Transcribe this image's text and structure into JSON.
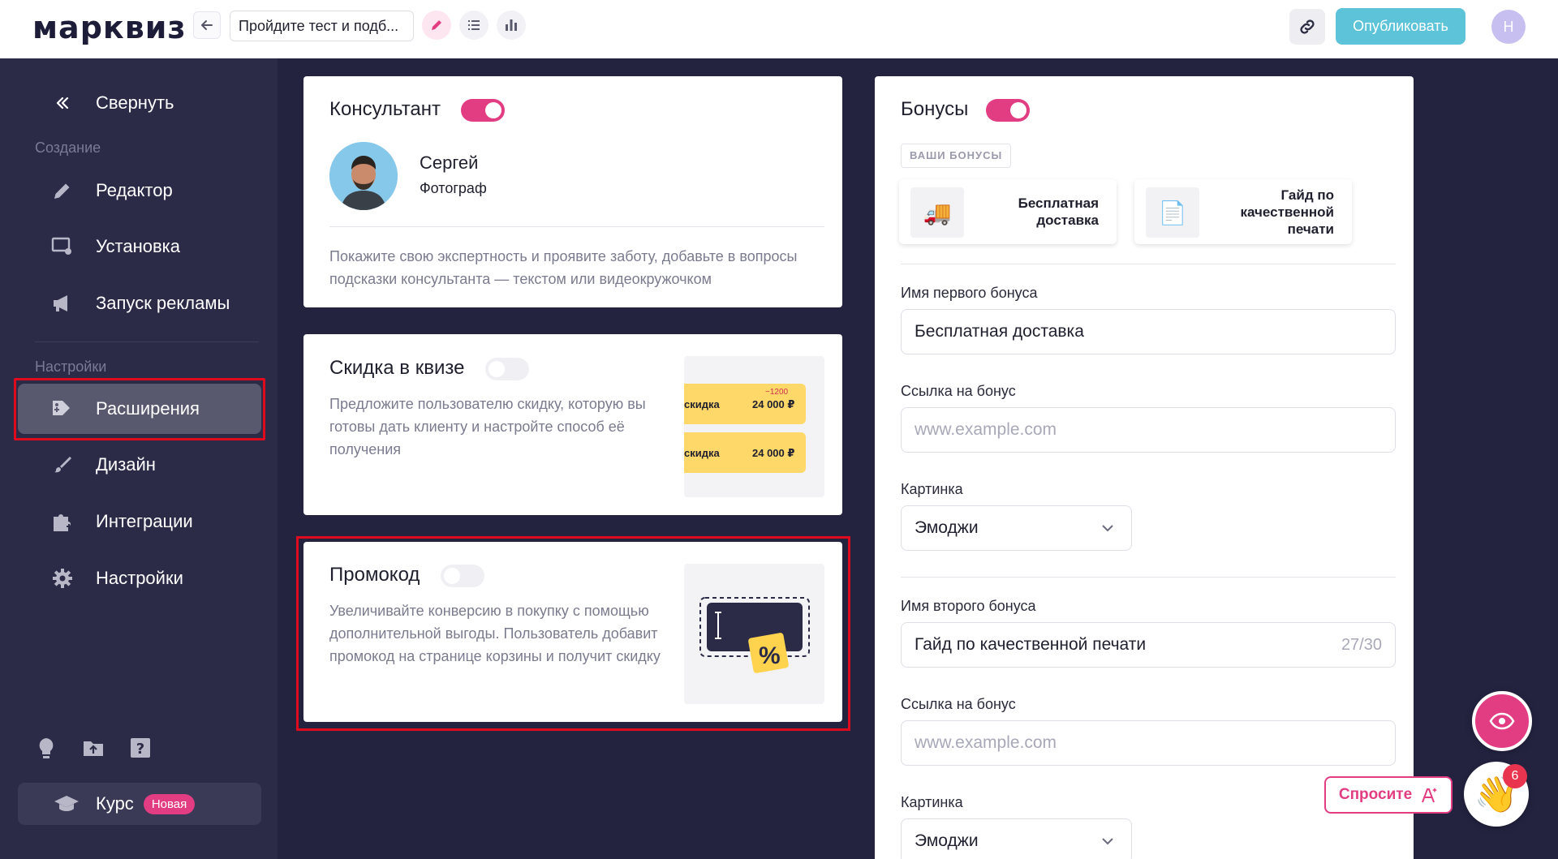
{
  "app": {
    "logo": "марквиз"
  },
  "header": {
    "quiz_title": "Пройдите тест и подб...",
    "publish_label": "Опубликовать",
    "user_initial": "Н"
  },
  "sidebar": {
    "collapse_label": "Свернуть",
    "section_create": "Создание",
    "section_settings": "Настройки",
    "items": [
      {
        "label": "Редактор",
        "icon": "pencil-icon"
      },
      {
        "label": "Установка",
        "icon": "install-icon"
      },
      {
        "label": "Запуск рекламы",
        "icon": "megaphone-icon"
      },
      {
        "label": "Расширения",
        "icon": "extensions-icon",
        "active": true
      },
      {
        "label": "Дизайн",
        "icon": "brush-icon"
      },
      {
        "label": "Интеграции",
        "icon": "puzzle-icon"
      },
      {
        "label": "Настройки",
        "icon": "gear-icon"
      }
    ],
    "course_label": "Курс",
    "course_badge": "Новая"
  },
  "consultant": {
    "title": "Консультант",
    "enabled": true,
    "name": "Сергей",
    "role": "Фотограф",
    "description": "Покажите свою экспертность и проявите заботу, добавьте в вопросы подсказки консультанта — текстом или видеокружочком"
  },
  "discount": {
    "title": "Скидка в квизе",
    "enabled": false,
    "description": "Предложите пользователю скидку, которую вы готовы дать клиенту и настройте способ её получения",
    "coupon_text": "скидка",
    "coupon_price": "24 000 ₽",
    "coupon_delta": "−1200"
  },
  "promo": {
    "title": "Промокод",
    "enabled": false,
    "description": "Увеличивайте конверсию в покупку с помощью дополнительной выгоды. Пользователь добавит промокод на странице корзины и получит скидку",
    "percent_glyph": "%"
  },
  "bonuses": {
    "title": "Бонусы",
    "enabled": true,
    "chip": "ВАШИ БОНУСЫ",
    "cards": [
      {
        "icon": "🚚",
        "label": "Бесплатная доставка"
      },
      {
        "icon": "📄",
        "label": "Гайд по качественной печати"
      }
    ],
    "first": {
      "name_label": "Имя первого бонуса",
      "name_value": "Бесплатная доставка",
      "link_label": "Ссылка на бонус",
      "link_placeholder": "www.example.com",
      "image_label": "Картинка",
      "image_value": "Эмоджи"
    },
    "second": {
      "name_label": "Имя второго бонуса",
      "name_value": "Гайд по качественной печати",
      "name_counter": "27/30",
      "link_label": "Ссылка на бонус",
      "link_placeholder": "www.example.com",
      "image_label": "Картинка",
      "image_value": "Эмоджи"
    }
  },
  "floating": {
    "ask_label": "Спросите",
    "wave_emoji": "👋",
    "notifications": "6"
  },
  "colors": {
    "accent": "#e23d82",
    "publish": "#5dc3d8",
    "sidebar": "#2b2b48",
    "background": "#232340",
    "highlight": "#e00a1e"
  }
}
